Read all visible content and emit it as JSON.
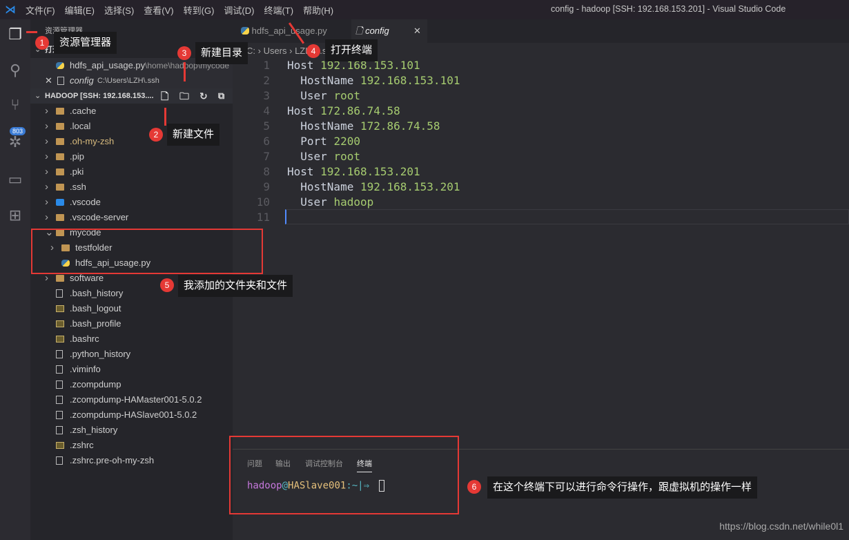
{
  "titlebar": {
    "menus": [
      "文件(F)",
      "编辑(E)",
      "选择(S)",
      "查看(V)",
      "转到(G)",
      "调试(D)",
      "终端(T)",
      "帮助(H)"
    ],
    "title": "config - hadoop [SSH: 192.168.153.201] - Visual Studio Code"
  },
  "activity": {
    "badge": "803",
    "icons": [
      "files-icon",
      "search-icon",
      "source-control-icon",
      "debug-icon",
      "remote-explorer-icon",
      "extensions-icon"
    ]
  },
  "sidebar": {
    "title": "资源管理器",
    "open_editors_label": "打开的编辑器",
    "open_editors": [
      {
        "name": "hdfs_api_usage.py",
        "path": "\\home\\hadoop\\mycode"
      },
      {
        "name": "config",
        "path": "C:\\Users\\LZH\\.ssh"
      }
    ],
    "workspace_label": "HADOOP [SSH: 192.168.153....",
    "tree": [
      {
        "name": ".cache",
        "type": "folder",
        "depth": 0
      },
      {
        "name": ".local",
        "type": "folder",
        "depth": 0
      },
      {
        "name": ".oh-my-zsh",
        "type": "folder",
        "depth": 0,
        "modified": true
      },
      {
        "name": ".pip",
        "type": "folder",
        "depth": 0
      },
      {
        "name": ".pki",
        "type": "folder",
        "depth": 0
      },
      {
        "name": ".ssh",
        "type": "folder",
        "depth": 0
      },
      {
        "name": ".vscode",
        "type": "vscode",
        "depth": 0
      },
      {
        "name": ".vscode-server",
        "type": "folder",
        "depth": 0
      },
      {
        "name": "mycode",
        "type": "folder",
        "depth": 0,
        "open": true
      },
      {
        "name": "testfolder",
        "type": "folder",
        "depth": 1
      },
      {
        "name": "hdfs_api_usage.py",
        "type": "py",
        "depth": 1
      },
      {
        "name": "software",
        "type": "folder",
        "depth": 0
      },
      {
        "name": ".bash_history",
        "type": "file",
        "depth": 0
      },
      {
        "name": ".bash_logout",
        "type": "shell",
        "depth": 0
      },
      {
        "name": ".bash_profile",
        "type": "shell",
        "depth": 0
      },
      {
        "name": ".bashrc",
        "type": "shell",
        "depth": 0
      },
      {
        "name": ".python_history",
        "type": "file",
        "depth": 0
      },
      {
        "name": ".viminfo",
        "type": "file",
        "depth": 0
      },
      {
        "name": ".zcompdump",
        "type": "file",
        "depth": 0
      },
      {
        "name": ".zcompdump-HAMaster001-5.0.2",
        "type": "file",
        "depth": 0
      },
      {
        "name": ".zcompdump-HASlave001-5.0.2",
        "type": "file",
        "depth": 0
      },
      {
        "name": ".zsh_history",
        "type": "file",
        "depth": 0
      },
      {
        "name": ".zshrc",
        "type": "shell",
        "depth": 0
      },
      {
        "name": ".zshrc.pre-oh-my-zsh",
        "type": "file",
        "depth": 0
      }
    ]
  },
  "editor": {
    "tabs": [
      {
        "name": "hdfs_api_usage.py",
        "active": false
      },
      {
        "name": "config",
        "active": true
      }
    ],
    "breadcrumb": [
      "C:",
      "Users",
      "LZH",
      ".ssh",
      "config"
    ],
    "lines": [
      [
        "Host ",
        "192.168.153.101"
      ],
      [
        "  HostName ",
        "192.168.153.101"
      ],
      [
        "  User ",
        "root"
      ],
      [
        "Host ",
        "172.86.74.58"
      ],
      [
        "  HostName ",
        "172.86.74.58"
      ],
      [
        "  Port ",
        "2200"
      ],
      [
        "  User ",
        "root"
      ],
      [
        "Host ",
        "192.168.153.201"
      ],
      [
        "  HostName ",
        "192.168.153.201"
      ],
      [
        "  User ",
        "hadoop"
      ],
      [
        "",
        ""
      ]
    ]
  },
  "panel": {
    "tabs": [
      "问题",
      "输出",
      "调试控制台",
      "终端"
    ],
    "active_tab": "终端",
    "prompt_user": "hadoop",
    "prompt_at": "@",
    "prompt_host": "HASlave001",
    "prompt_rest": ":~|⇒"
  },
  "annotations": [
    {
      "num": "1",
      "label": "资源管理器"
    },
    {
      "num": "2",
      "label": "新建文件"
    },
    {
      "num": "3",
      "label": "新建目录"
    },
    {
      "num": "4",
      "label": "打开终端"
    },
    {
      "num": "5",
      "label": "我添加的文件夹和文件"
    },
    {
      "num": "6",
      "label": "在这个终端下可以进行命令行操作，跟虚拟机的操作一样"
    }
  ],
  "watermark": "https://blog.csdn.net/while0l1",
  "colors": {
    "accent_red": "#e53935",
    "string_green": "#a6cc70",
    "prompt_purple": "#c678dd",
    "prompt_yellow": "#e5c07b",
    "prompt_cyan": "#56b6c2"
  }
}
